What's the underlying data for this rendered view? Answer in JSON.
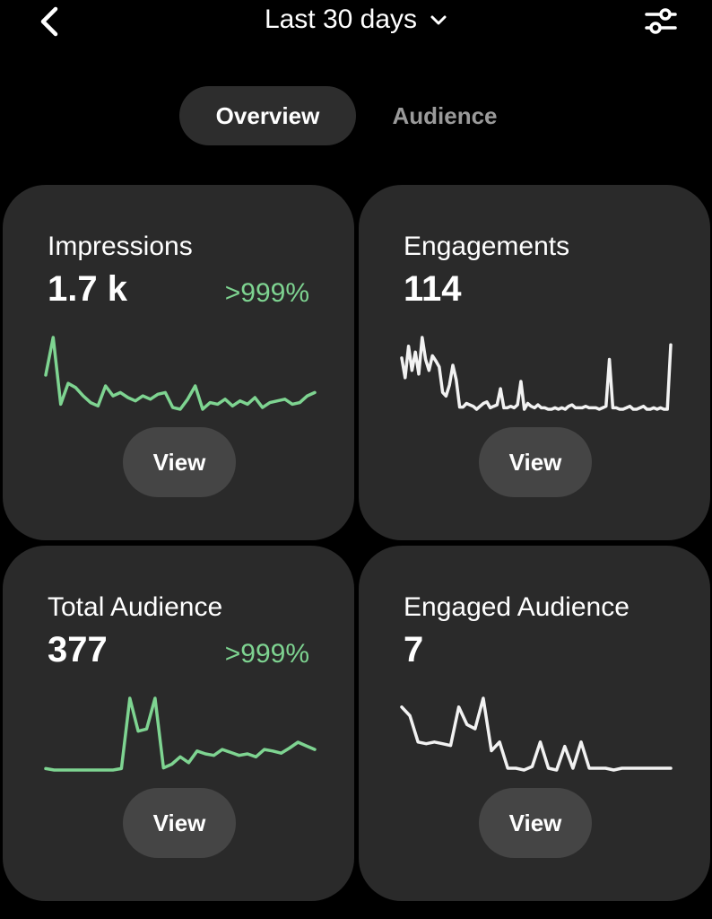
{
  "header": {
    "date_range": "Last 30 days"
  },
  "tabs": [
    {
      "label": "Overview",
      "active": true
    },
    {
      "label": "Audience",
      "active": false
    }
  ],
  "colors": {
    "positive": "#7ed491",
    "neutral_line": "#f2f2f2",
    "card_bg": "#2a2a2a",
    "button_bg": "#454545"
  },
  "cards": [
    {
      "title": "Impressions",
      "value": "1.7 k",
      "delta": ">999%",
      "button": "View",
      "spark_color": "#7ed491",
      "series": [
        55,
        100,
        20,
        45,
        40,
        30,
        22,
        18,
        42,
        30,
        34,
        28,
        24,
        30,
        26,
        32,
        34,
        16,
        14,
        26,
        42,
        14,
        22,
        20,
        26,
        18,
        24,
        20,
        28,
        16,
        22,
        24,
        26,
        20,
        22,
        30,
        34
      ]
    },
    {
      "title": "Engagements",
      "value": "114",
      "delta": "",
      "button": "View",
      "spark_color": "#f2f2f2",
      "series": [
        72,
        45,
        88,
        55,
        80,
        50,
        100,
        70,
        55,
        75,
        68,
        60,
        25,
        20,
        35,
        62,
        42,
        5,
        5,
        10,
        8,
        6,
        2,
        6,
        10,
        12,
        4,
        6,
        8,
        30,
        4,
        4,
        6,
        4,
        8,
        40,
        2,
        10,
        6,
        4,
        8,
        4,
        4,
        2,
        2,
        4,
        2,
        4,
        2,
        6,
        8,
        4,
        4,
        4,
        6,
        4,
        4,
        4,
        2,
        4,
        6,
        70,
        4,
        4,
        2,
        2,
        4,
        6,
        2,
        2,
        4,
        6,
        2,
        2,
        4,
        2,
        4,
        2,
        2,
        90
      ]
    },
    {
      "title": "Total Audience",
      "value": "377",
      "delta": ">999%",
      "button": "View",
      "spark_color": "#7ed491",
      "series": [
        4,
        2,
        2,
        2,
        2,
        2,
        2,
        2,
        2,
        4,
        100,
        55,
        58,
        100,
        5,
        10,
        20,
        12,
        28,
        24,
        22,
        30,
        26,
        22,
        24,
        20,
        30,
        28,
        25,
        32,
        40,
        35,
        30
      ]
    },
    {
      "title": "Engaged Audience",
      "value": "7",
      "delta": "",
      "button": "View",
      "spark_color": "#f2f2f2",
      "series": [
        80,
        70,
        40,
        38,
        40,
        38,
        36,
        80,
        60,
        55,
        90,
        30,
        40,
        10,
        10,
        8,
        12,
        40,
        10,
        8,
        35,
        10,
        40,
        10,
        10,
        10,
        8,
        10,
        10,
        10,
        10,
        10,
        10,
        10
      ]
    }
  ]
}
